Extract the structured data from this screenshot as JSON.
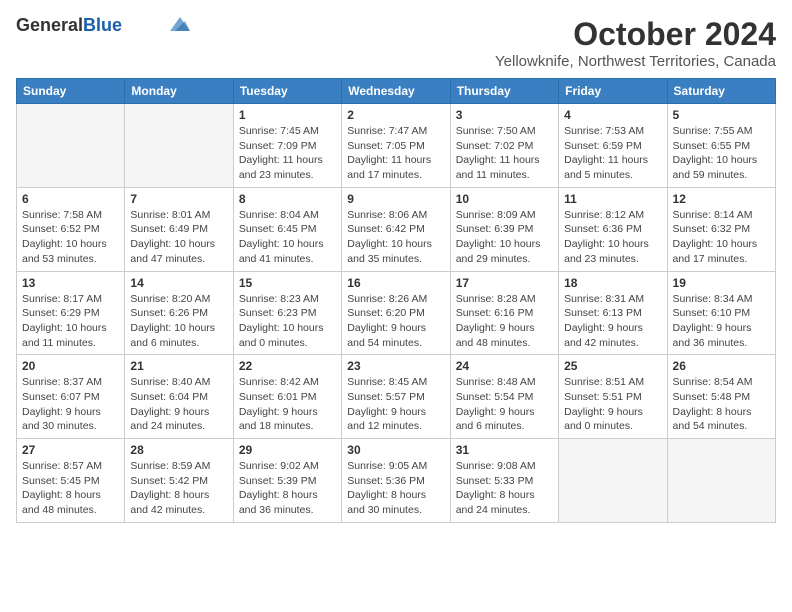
{
  "header": {
    "logo_general": "General",
    "logo_blue": "Blue",
    "month_title": "October 2024",
    "subtitle": "Yellowknife, Northwest Territories, Canada"
  },
  "days_of_week": [
    "Sunday",
    "Monday",
    "Tuesday",
    "Wednesday",
    "Thursday",
    "Friday",
    "Saturday"
  ],
  "weeks": [
    [
      {
        "day": "",
        "info": ""
      },
      {
        "day": "",
        "info": ""
      },
      {
        "day": "1",
        "info": "Sunrise: 7:45 AM\nSunset: 7:09 PM\nDaylight: 11 hours and 23 minutes."
      },
      {
        "day": "2",
        "info": "Sunrise: 7:47 AM\nSunset: 7:05 PM\nDaylight: 11 hours and 17 minutes."
      },
      {
        "day": "3",
        "info": "Sunrise: 7:50 AM\nSunset: 7:02 PM\nDaylight: 11 hours and 11 minutes."
      },
      {
        "day": "4",
        "info": "Sunrise: 7:53 AM\nSunset: 6:59 PM\nDaylight: 11 hours and 5 minutes."
      },
      {
        "day": "5",
        "info": "Sunrise: 7:55 AM\nSunset: 6:55 PM\nDaylight: 10 hours and 59 minutes."
      }
    ],
    [
      {
        "day": "6",
        "info": "Sunrise: 7:58 AM\nSunset: 6:52 PM\nDaylight: 10 hours and 53 minutes."
      },
      {
        "day": "7",
        "info": "Sunrise: 8:01 AM\nSunset: 6:49 PM\nDaylight: 10 hours and 47 minutes."
      },
      {
        "day": "8",
        "info": "Sunrise: 8:04 AM\nSunset: 6:45 PM\nDaylight: 10 hours and 41 minutes."
      },
      {
        "day": "9",
        "info": "Sunrise: 8:06 AM\nSunset: 6:42 PM\nDaylight: 10 hours and 35 minutes."
      },
      {
        "day": "10",
        "info": "Sunrise: 8:09 AM\nSunset: 6:39 PM\nDaylight: 10 hours and 29 minutes."
      },
      {
        "day": "11",
        "info": "Sunrise: 8:12 AM\nSunset: 6:36 PM\nDaylight: 10 hours and 23 minutes."
      },
      {
        "day": "12",
        "info": "Sunrise: 8:14 AM\nSunset: 6:32 PM\nDaylight: 10 hours and 17 minutes."
      }
    ],
    [
      {
        "day": "13",
        "info": "Sunrise: 8:17 AM\nSunset: 6:29 PM\nDaylight: 10 hours and 11 minutes."
      },
      {
        "day": "14",
        "info": "Sunrise: 8:20 AM\nSunset: 6:26 PM\nDaylight: 10 hours and 6 minutes."
      },
      {
        "day": "15",
        "info": "Sunrise: 8:23 AM\nSunset: 6:23 PM\nDaylight: 10 hours and 0 minutes."
      },
      {
        "day": "16",
        "info": "Sunrise: 8:26 AM\nSunset: 6:20 PM\nDaylight: 9 hours and 54 minutes."
      },
      {
        "day": "17",
        "info": "Sunrise: 8:28 AM\nSunset: 6:16 PM\nDaylight: 9 hours and 48 minutes."
      },
      {
        "day": "18",
        "info": "Sunrise: 8:31 AM\nSunset: 6:13 PM\nDaylight: 9 hours and 42 minutes."
      },
      {
        "day": "19",
        "info": "Sunrise: 8:34 AM\nSunset: 6:10 PM\nDaylight: 9 hours and 36 minutes."
      }
    ],
    [
      {
        "day": "20",
        "info": "Sunrise: 8:37 AM\nSunset: 6:07 PM\nDaylight: 9 hours and 30 minutes."
      },
      {
        "day": "21",
        "info": "Sunrise: 8:40 AM\nSunset: 6:04 PM\nDaylight: 9 hours and 24 minutes."
      },
      {
        "day": "22",
        "info": "Sunrise: 8:42 AM\nSunset: 6:01 PM\nDaylight: 9 hours and 18 minutes."
      },
      {
        "day": "23",
        "info": "Sunrise: 8:45 AM\nSunset: 5:57 PM\nDaylight: 9 hours and 12 minutes."
      },
      {
        "day": "24",
        "info": "Sunrise: 8:48 AM\nSunset: 5:54 PM\nDaylight: 9 hours and 6 minutes."
      },
      {
        "day": "25",
        "info": "Sunrise: 8:51 AM\nSunset: 5:51 PM\nDaylight: 9 hours and 0 minutes."
      },
      {
        "day": "26",
        "info": "Sunrise: 8:54 AM\nSunset: 5:48 PM\nDaylight: 8 hours and 54 minutes."
      }
    ],
    [
      {
        "day": "27",
        "info": "Sunrise: 8:57 AM\nSunset: 5:45 PM\nDaylight: 8 hours and 48 minutes."
      },
      {
        "day": "28",
        "info": "Sunrise: 8:59 AM\nSunset: 5:42 PM\nDaylight: 8 hours and 42 minutes."
      },
      {
        "day": "29",
        "info": "Sunrise: 9:02 AM\nSunset: 5:39 PM\nDaylight: 8 hours and 36 minutes."
      },
      {
        "day": "30",
        "info": "Sunrise: 9:05 AM\nSunset: 5:36 PM\nDaylight: 8 hours and 30 minutes."
      },
      {
        "day": "31",
        "info": "Sunrise: 9:08 AM\nSunset: 5:33 PM\nDaylight: 8 hours and 24 minutes."
      },
      {
        "day": "",
        "info": ""
      },
      {
        "day": "",
        "info": ""
      }
    ]
  ]
}
